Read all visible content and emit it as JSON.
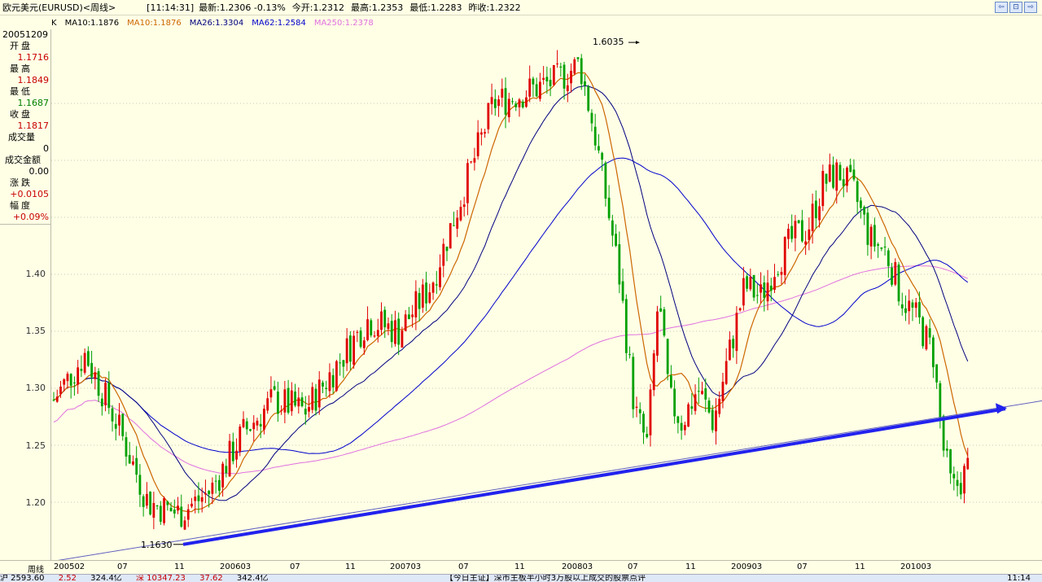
{
  "header": {
    "title": "欧元美元(EURUSD)<周线>",
    "time": "[11:14:31]",
    "latest_label": "最新:",
    "latest_value": "1.2306 -0.13%",
    "open_label": "今开:",
    "open_value": "1.2312",
    "high_label": "最高:",
    "high_value": "1.2353",
    "low_label": "最低:",
    "low_value": "1.2283",
    "prev_label": "昨收:",
    "prev_value": "1.2322"
  },
  "ma_legend": {
    "k": "K",
    "ma10a": "MA10:1.1876",
    "ma10b": "MA10:1.1876",
    "ma26": "MA26:1.3304",
    "ma62": "MA62:1.2584",
    "ma250": "MA250:1.2378",
    "colors": {
      "k": "#000000",
      "ma10a": "#000000",
      "ma10b": "#CC6600",
      "ma26": "#000080",
      "ma62": "#0000CC",
      "ma250": "#E070E0"
    }
  },
  "info": {
    "date": "20051209",
    "open_label": "开盘",
    "open": "1.1716",
    "high_label": "最高",
    "high": "1.1849",
    "low_label": "最低",
    "low": "1.1687",
    "close_label": "收盘",
    "close": "1.1817",
    "volume_label": "成交量",
    "volume": "0",
    "amount_label": "成交金额",
    "amount": "0.00",
    "change_label": "涨跌",
    "change": "+0.0105",
    "pct_label": "幅度",
    "pct": "+0.09%"
  },
  "annotations": {
    "high_label": "1.6035",
    "low_label": "1.1630"
  },
  "ticker": [
    "沪 2593.60",
    "2.52",
    "324.4亿",
    "深 10347.23",
    "37.62",
    "342.4亿",
    "【今日主证】深市主板半小时3万股以上成交的股票点评",
    "11:14"
  ],
  "colors": {
    "background": "#FFFFE6",
    "up": "#E00000",
    "down": "#00A000",
    "trendline": "#2222EE",
    "grid": "#C8C8B4"
  },
  "chart_data": {
    "type": "candlestick",
    "title": "欧元美元(EURUSD)<周线>",
    "ylim": [
      1.16,
      1.62
    ],
    "y_ticks": [
      "1.20",
      "1.25",
      "1.30",
      "1.35",
      "1.40"
    ],
    "x_ticks": [
      "200502",
      "07",
      "11",
      "200603",
      "07",
      "11",
      "200703",
      "07",
      "11",
      "200803",
      "07",
      "11",
      "200903",
      "07",
      "11",
      "201003"
    ],
    "x_label": "周线",
    "high_mark": {
      "value": "1.6035",
      "week": 202
    },
    "low_mark": {
      "value": "1.1630",
      "week": 44
    },
    "trendline": {
      "from": [
        44,
        1.163
      ],
      "to": [
        252,
        1.282
      ]
    },
    "weeks": 270,
    "last": {
      "open": 1.1716,
      "high": 1.1849,
      "low": 1.1687,
      "close": 1.1817
    }
  }
}
